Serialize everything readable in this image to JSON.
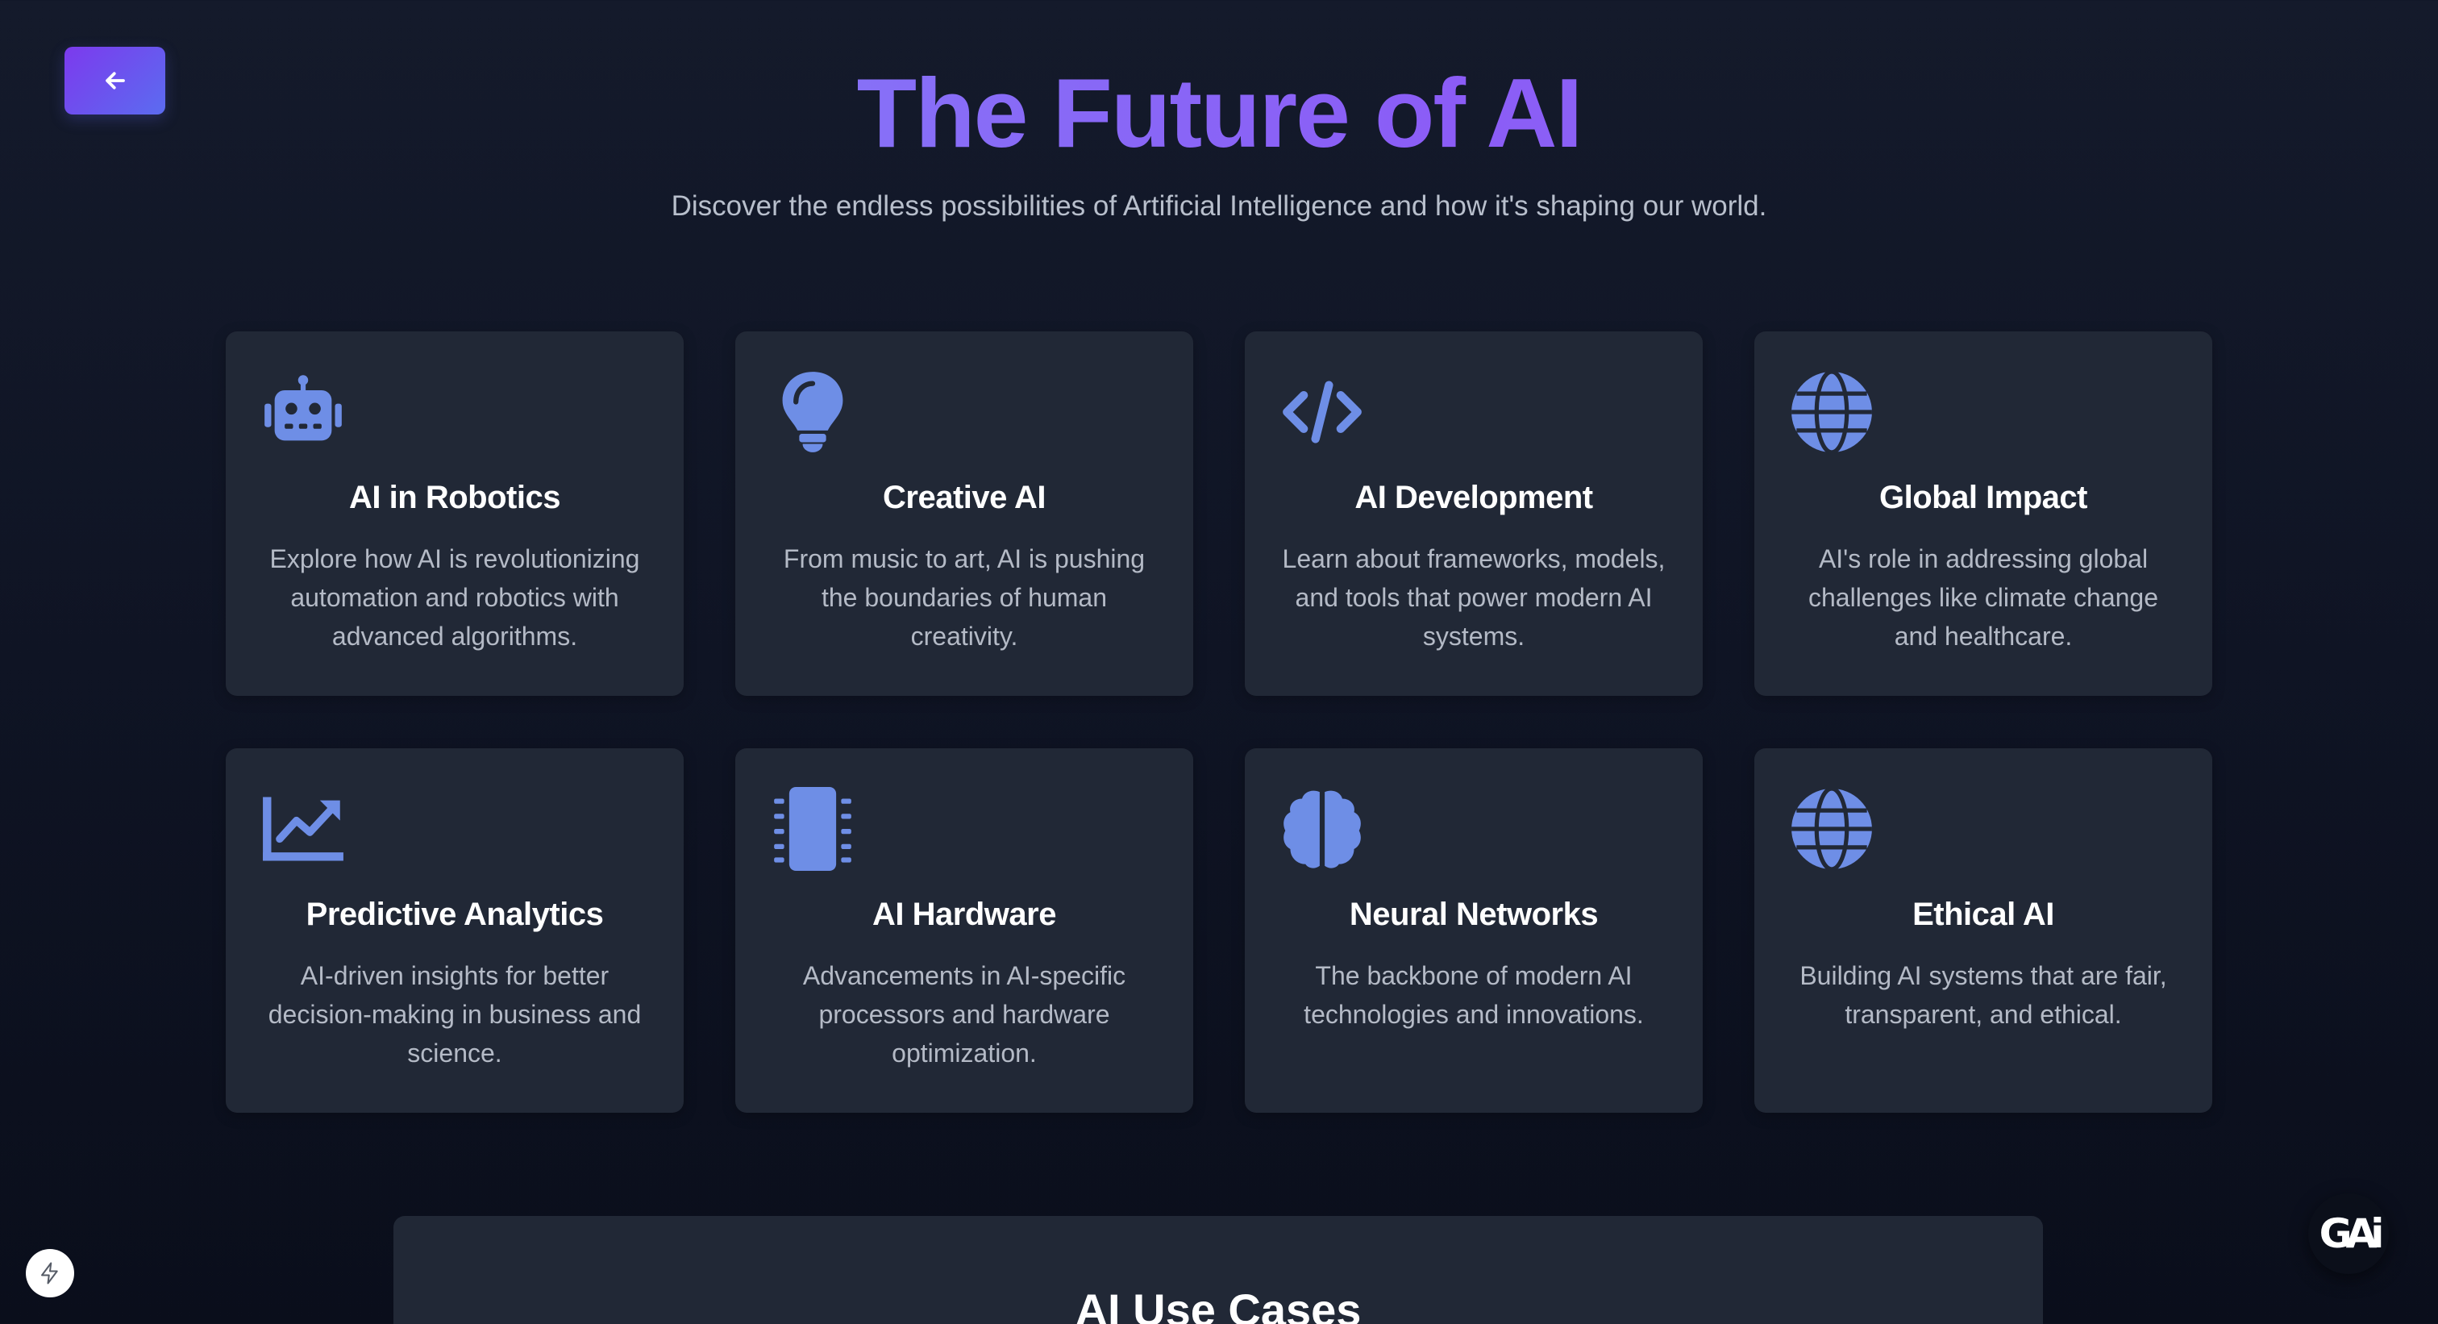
{
  "header": {
    "back_label": "",
    "title": "The Future of AI",
    "subtitle": "Discover the endless possibilities of Artificial Intelligence and how it's shaping our world."
  },
  "colors": {
    "accent": "#6e8ee6",
    "card_background": "#212836",
    "title_gradient_start": "#818cf8",
    "title_gradient_end": "#8b5cf6"
  },
  "cards": [
    {
      "icon": "robot-icon",
      "title": "AI in Robotics",
      "description": "Explore how AI is revolutionizing automation and robotics with advanced algorithms."
    },
    {
      "icon": "lightbulb-icon",
      "title": "Creative AI",
      "description": "From music to art, AI is pushing the boundaries of human creativity."
    },
    {
      "icon": "code-icon",
      "title": "AI Development",
      "description": "Learn about frameworks, models, and tools that power modern AI systems."
    },
    {
      "icon": "globe-icon",
      "title": "Global Impact",
      "description": "AI's role in addressing global challenges like climate change and healthcare."
    },
    {
      "icon": "chart-line-icon",
      "title": "Predictive Analytics",
      "description": "AI-driven insights for better decision-making in business and science."
    },
    {
      "icon": "microchip-icon",
      "title": "AI Hardware",
      "description": "Advancements in AI-specific processors and hardware optimization."
    },
    {
      "icon": "brain-icon",
      "title": "Neural Networks",
      "description": "The backbone of modern AI technologies and innovations."
    },
    {
      "icon": "globe-icon",
      "title": "Ethical AI",
      "description": "Building AI systems that are fair, transparent, and ethical."
    }
  ],
  "use_cases": {
    "title": "AI Use Cases"
  },
  "badge": {
    "text": "GAi"
  }
}
